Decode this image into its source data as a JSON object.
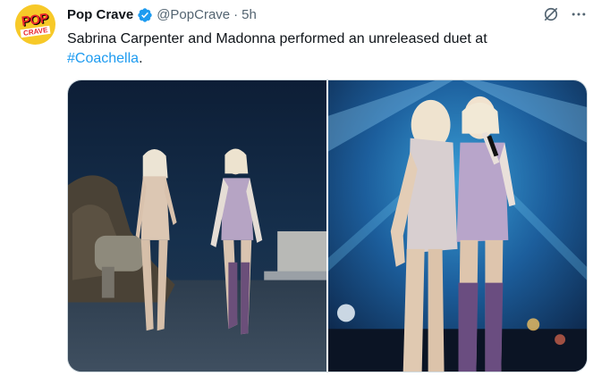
{
  "author": {
    "display_name": "Pop Crave",
    "handle": "@PopCrave",
    "separator": "·",
    "time": "5h",
    "verified": true,
    "avatar": {
      "logo_top": "POP",
      "logo_bottom": "CRAVE",
      "background": "#f7c928",
      "logo_color": "#e8232b"
    }
  },
  "tweet": {
    "text": "Sabrina Carpenter and Madonna performed an unreleased duet at",
    "hashtag": "#Coachella",
    "after_hashtag": "."
  },
  "actions": {
    "grok_icon": "grok-icon",
    "more_icon": "more-horizontal-icon"
  },
  "media": {
    "photos": [
      {
        "icon": "photo-performers-walking"
      },
      {
        "icon": "photo-performers-embrace"
      }
    ]
  },
  "colors": {
    "text": "#0f1419",
    "secondary": "#536471",
    "accent": "#1d9bf0",
    "border": "#cfd9de"
  }
}
